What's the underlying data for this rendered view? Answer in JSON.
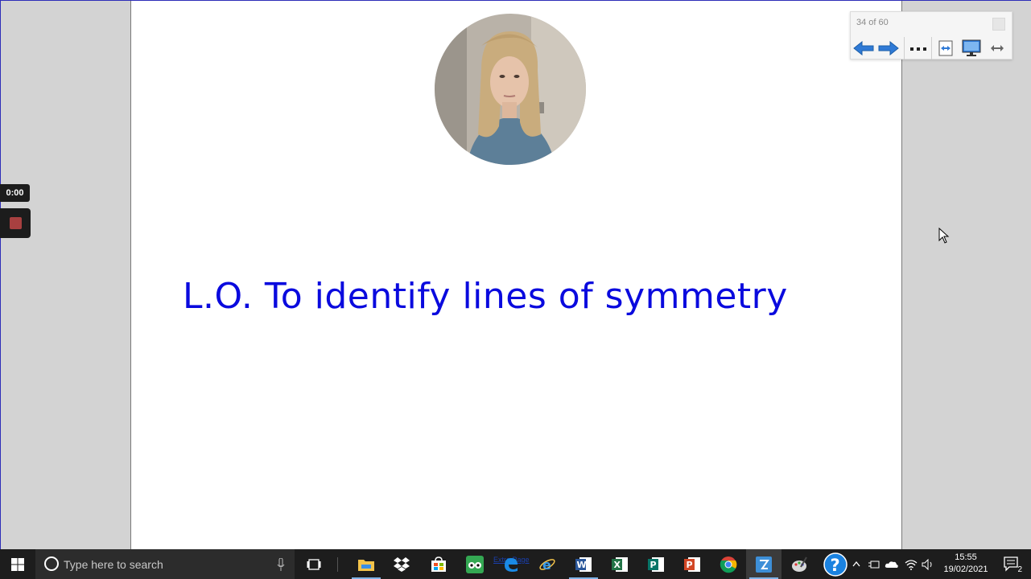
{
  "recorder": {
    "timer": "0:00"
  },
  "navigator": {
    "page_count": "34 of 60"
  },
  "slide": {
    "title": "L.O. To identify lines of symmetry"
  },
  "taskbar": {
    "search_placeholder": "Type here to search",
    "extra_page_label": "Extra Page",
    "time": "15:55",
    "date": "19/02/2021",
    "notification_count": "2"
  },
  "colors": {
    "title": "#0a0ade",
    "taskbar": "#1d1d1d",
    "workspace": "#d3d3d3"
  }
}
